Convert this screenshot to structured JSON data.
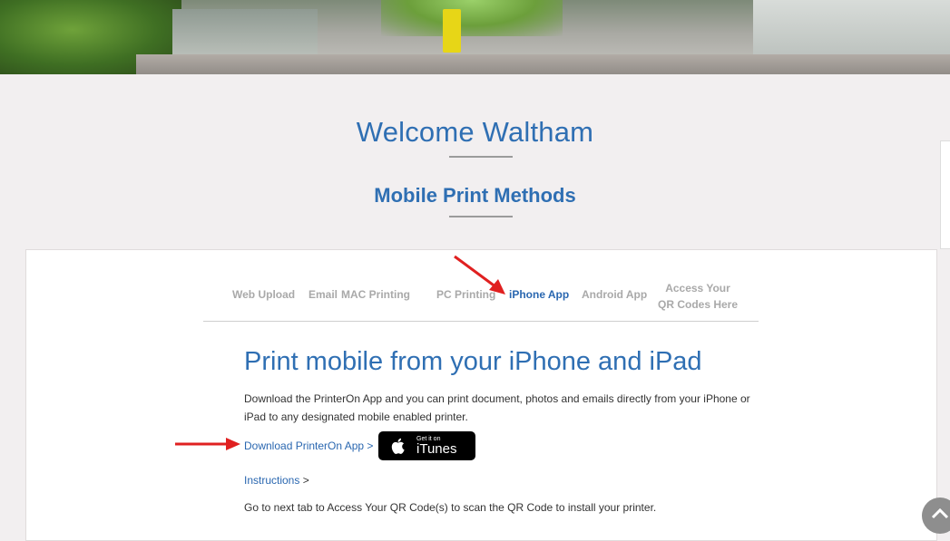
{
  "header": {
    "welcome": "Welcome Waltham",
    "subtitle": "Mobile Print Methods"
  },
  "tabs": [
    {
      "label": "Web Upload",
      "active": false
    },
    {
      "label": "Email",
      "active": false
    },
    {
      "label": "MAC Printing",
      "active": false
    },
    {
      "label": "PC Printing",
      "active": false
    },
    {
      "label": "iPhone App",
      "active": true
    },
    {
      "label": "Android App",
      "active": false
    },
    {
      "label_line1": "Access Your",
      "label_line2": "QR Codes Here",
      "active": false
    }
  ],
  "content": {
    "heading": "Print mobile from your iPhone and iPad",
    "description": "Download the PrinterOn App and you can print document, photos and emails directly from your iPhone or iPad to any designated mobile enabled printer.",
    "download_link": "Download PrinterOn App",
    "download_link_suffix": " >",
    "itunes_small": "Get it on",
    "itunes_big": "iTunes",
    "instructions_link": "Instructions",
    "instructions_suffix": " >",
    "note": "Go to next tab to Access Your QR Code(s) to scan the QR Code to install your printer."
  },
  "colors": {
    "accent": "#2f6fb3",
    "annotation_arrow": "#e02020",
    "background": "#f2eff0"
  },
  "icons": [
    "apple-icon",
    "chevron-up-icon",
    "arrow-annotation"
  ]
}
